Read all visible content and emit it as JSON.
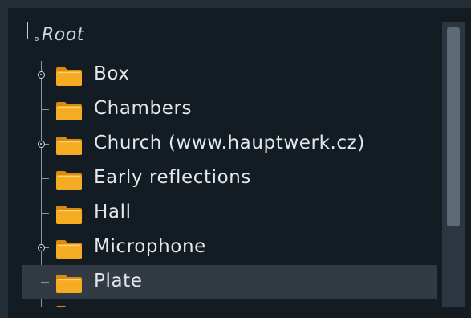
{
  "tree": {
    "root": {
      "label": "Root"
    },
    "items": [
      {
        "label": "Box",
        "expandable": true,
        "selected": false,
        "icon": "folder-icon"
      },
      {
        "label": "Chambers",
        "expandable": false,
        "selected": false,
        "icon": "folder-icon"
      },
      {
        "label": "Church (www.hauptwerk.cz)",
        "expandable": true,
        "selected": false,
        "icon": "folder-icon"
      },
      {
        "label": "Early reflections",
        "expandable": false,
        "selected": false,
        "icon": "folder-icon"
      },
      {
        "label": "Hall",
        "expandable": false,
        "selected": false,
        "icon": "folder-icon"
      },
      {
        "label": "Microphone",
        "expandable": true,
        "selected": false,
        "icon": "folder-icon"
      },
      {
        "label": "Plate",
        "expandable": false,
        "selected": true,
        "icon": "folder-icon"
      }
    ]
  },
  "colors": {
    "background": "#131c22",
    "selection": "#323b44",
    "text": "#e3e8ec",
    "folder": "#f4a51c",
    "scroll_thumb": "#5c6a76"
  }
}
